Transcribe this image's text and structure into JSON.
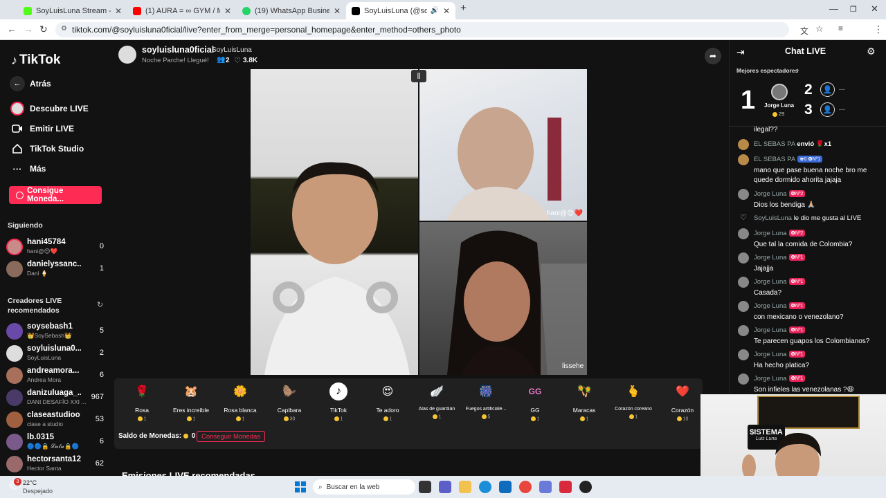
{
  "browser": {
    "tabs": [
      {
        "title": "SoyLuisLuna Stream - Watch Li",
        "color": "#53fc18"
      },
      {
        "title": "(1) AURA = ∞ GYM / MOTIVAT",
        "color": "#ff0000"
      },
      {
        "title": "(19) WhatsApp Business",
        "color": "#25d366"
      },
      {
        "title": "SoyLuisLuna (@soyluisluna",
        "color": "#000000"
      }
    ],
    "new_tab": "+",
    "minimize": "—",
    "maximize": "❐",
    "close": "✕",
    "url": "tiktok.com/@soyluisluna0ficial/live?enter_from_merge=personal_homepage&enter_method=others_photo"
  },
  "sidebar": {
    "logo": "TikTok",
    "back": "Atrás",
    "nav": [
      {
        "label": "Descubre LIVE",
        "icon": "avatar-icon"
      },
      {
        "label": "Emitir LIVE",
        "icon": "camera-icon"
      },
      {
        "label": "TikTok Studio",
        "icon": "home-icon"
      },
      {
        "label": "Más",
        "icon": "more-icon"
      }
    ],
    "coins_button": "Consigue Moneda...",
    "following_title": "Siguiendo",
    "following": [
      {
        "name": "hani45784",
        "sub": "hani@😍❤️",
        "count": "0",
        "color": "#c98a8a"
      },
      {
        "name": "danielyssanc...",
        "sub": "Dani 🍦",
        "count": "1",
        "color": "#8a6a5a"
      }
    ],
    "creators_title": "Creadores LIVE recomendados",
    "creators": [
      {
        "name": "soysebash1",
        "sub": "👑SoySebash👑",
        "count": "5",
        "color": "#6a4aa8"
      },
      {
        "name": "soyluisluna0...",
        "sub": "SoyLuisLuna",
        "count": "2",
        "color": "#ddd"
      },
      {
        "name": "andreamora...",
        "sub": "Andrea Mora",
        "count": "6",
        "color": "#a8705a"
      },
      {
        "name": "danizuluaga_...",
        "sub": "DANI DESAFÍO XXI ...",
        "count": "967",
        "color": "#4a3a6a"
      },
      {
        "name": "claseastudioo",
        "sub": "clase a studio",
        "count": "53",
        "color": "#a06040"
      },
      {
        "name": "lb.0315",
        "sub": "🔵🔵🔒 𝓛𝓾𝓵𝓾🔒🔵",
        "count": "6",
        "color": "#7a5a8a"
      },
      {
        "name": "hectorsanta12",
        "sub": "Hector Santa",
        "count": "62",
        "color": "#9a6a6a"
      }
    ]
  },
  "header": {
    "username": "soyluisluna0ficial",
    "display_name": "SoyLuisLuna",
    "status": "Noche Parche! Llegué!",
    "viewers": "2",
    "likes": "3.8K"
  },
  "video": {
    "label_top_right": "hani@😍❤️",
    "label_bottom_right": "lissehe"
  },
  "gifts": [
    {
      "name": "Rosa",
      "price": "1",
      "icon": "🌹"
    },
    {
      "name": "Eres increíble",
      "price": "1",
      "icon": "🐹"
    },
    {
      "name": "Rosa blanca",
      "price": "1",
      "icon": "🌼"
    },
    {
      "name": "Capibara",
      "price": "30",
      "icon": "🦫"
    },
    {
      "name": "TikTok",
      "price": "1",
      "icon": "♪"
    },
    {
      "name": "Te adoro",
      "price": "1",
      "icon": "😍"
    },
    {
      "name": "Alas de guardián",
      "price": "1",
      "icon": "🪽"
    },
    {
      "name": "Fuegos artificiale...",
      "price": "5",
      "icon": "🎆"
    },
    {
      "name": "GG",
      "price": "1",
      "icon": "GG"
    },
    {
      "name": "Maracas",
      "price": "1",
      "icon": "🪇"
    },
    {
      "name": "Corazón coreano",
      "price": "1",
      "icon": "🫰"
    },
    {
      "name": "Corazón",
      "price": "10",
      "icon": "❤️"
    }
  ],
  "balance": {
    "label": "Saldo de Monedas:",
    "value": "0",
    "button": "Conseguir Monedas"
  },
  "recommended_title": "Emisiones LIVE recomendadas",
  "chat": {
    "title": "Chat LIVE",
    "top_viewers_label": "Mejores espectadores",
    "top": [
      {
        "rank": "1",
        "name": "Jorge Luna",
        "score": "29"
      },
      {
        "rank": "2",
        "name": "---"
      },
      {
        "rank": "3",
        "name": "---"
      }
    ],
    "partial_first": "ilegal??",
    "messages": [
      {
        "user": "EL SEBAS PA",
        "badge": "",
        "text": "envió 🌹x1",
        "inline": true
      },
      {
        "user": "EL SEBAS PA",
        "badge": "♚0 ❻Nº1",
        "text": "mano que pase buena noche bro me quede dormido ahorita jajaja"
      },
      {
        "user": "Jorge Luna",
        "badge": "❻Nº2",
        "text": "Dios los bendiga 🙏🏼"
      },
      {
        "user": "SoyLuisLuna",
        "badge": "",
        "text": "le dio me gusta al LIVE",
        "inline": true
      },
      {
        "user": "Jorge Luna",
        "badge": "❻Nº2",
        "text": "Que tal la comida de Colombia?"
      },
      {
        "user": "Jorge Luna",
        "badge": "❻Nº1",
        "text": "Jajajja"
      },
      {
        "user": "Jorge Luna",
        "badge": "❻Nº1",
        "text": "Casada?"
      },
      {
        "user": "Jorge Luna",
        "badge": "❻Nº1",
        "text": "con mexicano o venezolano?"
      },
      {
        "user": "Jorge Luna",
        "badge": "❻Nº1",
        "text": "Te parecen guapos los Colombianos?"
      },
      {
        "user": "Jorge Luna",
        "badge": "❻Nº1",
        "text": "Ha hecho platica?"
      },
      {
        "user": "Jorge Luna",
        "badge": "❻Nº1",
        "text": "Son infieles las venezolanas ?😆"
      }
    ]
  },
  "webcam": {
    "sign_line1": "$ISTEMA",
    "sign_line2": "Luis Luna"
  },
  "taskbar": {
    "weather_temp": "22°C",
    "weather_desc": "Despejado",
    "search_placeholder": "Buscar en la web",
    "notification_count": "3"
  }
}
